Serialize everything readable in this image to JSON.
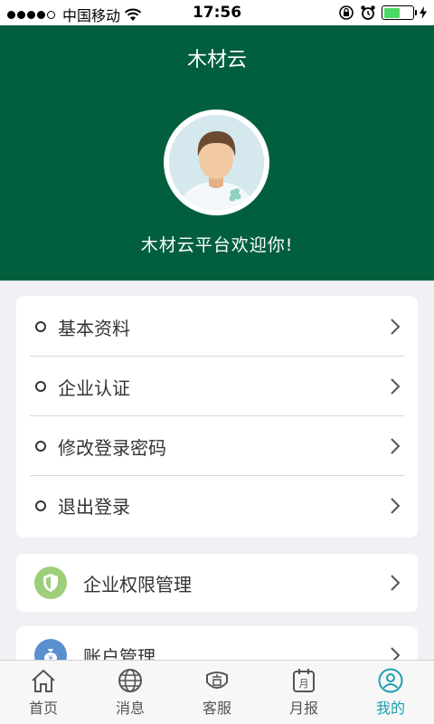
{
  "status": {
    "carrier": "中国移动",
    "time": "17:56"
  },
  "header": {
    "title": "木材云",
    "welcome": "木材云平台欢迎你!"
  },
  "menu": {
    "items": [
      {
        "label": "基本资料"
      },
      {
        "label": "企业认证"
      },
      {
        "label": "修改登录密码"
      },
      {
        "label": "退出登录"
      }
    ]
  },
  "permissions": {
    "label": "企业权限管理"
  },
  "account": {
    "label": "账户管理"
  },
  "tabs": [
    {
      "label": "首页",
      "icon": "home-icon"
    },
    {
      "label": "消息",
      "icon": "globe-icon"
    },
    {
      "label": "客服",
      "icon": "customer-service-icon"
    },
    {
      "label": "月报",
      "icon": "calendar-icon"
    },
    {
      "label": "我的",
      "icon": "user-icon"
    }
  ],
  "colors": {
    "header_bg": "#025f3e",
    "accent": "#1a9fb0",
    "shield_bg": "#9fce7a",
    "account_bg": "#5a8fd0"
  }
}
